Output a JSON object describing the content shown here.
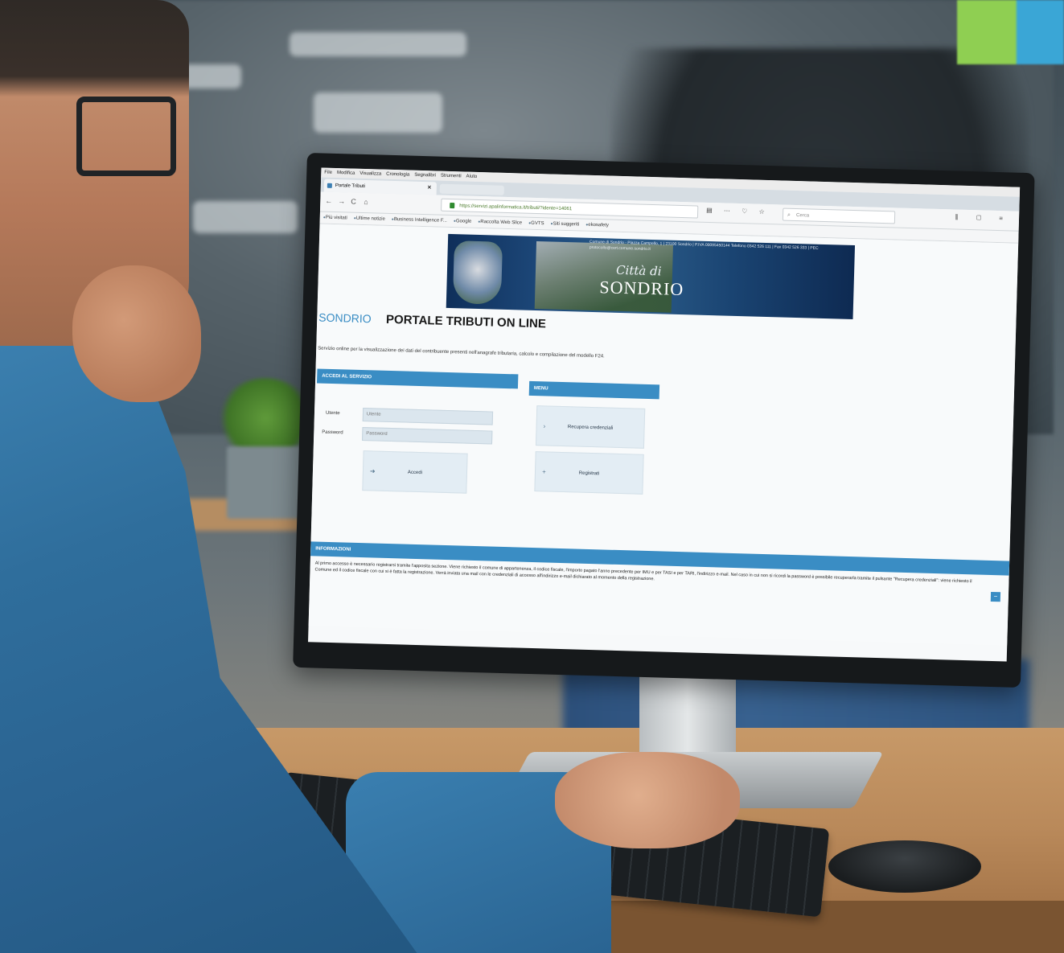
{
  "browser": {
    "menu": [
      "File",
      "Modifica",
      "Visualizza",
      "Cronologia",
      "Segnalibri",
      "Strumenti",
      "Aiuto"
    ],
    "tab_title": "Portale Tributi",
    "url": "https://servizi.apalinformatica.it/tributi/?idente=14061",
    "search_placeholder": "Cerca",
    "bookmarks": [
      "Più visitati",
      "Ultime notizie",
      "Business Intelligence F...",
      "Google",
      "Raccolta Web Slice",
      "GVTS",
      "Siti suggeriti",
      "ekosafety"
    ]
  },
  "banner": {
    "info": "Comune di Sondrio - Piazza Campello, 1 | 23100 Sondrio | P.IVA 00095450144 Telefono 0342 526 111 | Fax 0342 526 333 | PEC protocollo@cert.comune.sondrio.it",
    "city_prefix": "Città di",
    "city": "SONDRIO"
  },
  "header": {
    "brand": "SONDRIO",
    "title": "PORTALE TRIBUTI ON LINE",
    "subtitle": "Servizio online per la visualizzazione dei dati del contribuente presenti nell'anagrafe tributaria, calcolo e compilazione del modello F24."
  },
  "login": {
    "heading": "ACCEDI AL SERVIZIO",
    "username_label": "Utente",
    "username_placeholder": "Utente",
    "password_label": "Password",
    "password_placeholder": "Password",
    "submit_label": "Accedi"
  },
  "menu": {
    "heading": "MENU",
    "items": [
      "Recupera credenziali",
      "Registrati"
    ]
  },
  "info": {
    "heading": "INFORMAZIONI",
    "text": "Al primo accesso è necessario registrarsi tramite l'apposita sezione. Viene richiesto il comune di appartenenza, il codice fiscale, l'importo pagato l'anno precedente per IMU e per TASI e per TARI, l'indirizzo e-mail. Nel caso in cui non si ricordi la password è possibile recuperarla tramite il pulsante \"Recupera credenziali\": viene richiesto il Comune ed il codice fiscale con cui si è fatta la registrazione. Verrà inviata una mail con le credenziali di accesso all'indirizzo e-mail dichiarato al momento della registrazione.",
    "toggle": "−"
  },
  "icons": {
    "back": "←",
    "forward": "→",
    "reload": "C",
    "home": "⌂",
    "search": "⌕",
    "login_arrow": "➜",
    "menu_item_1": "›",
    "menu_item_2": "+"
  },
  "colors": {
    "accent": "#3a8dc4",
    "banner": "#1e4a7c"
  }
}
